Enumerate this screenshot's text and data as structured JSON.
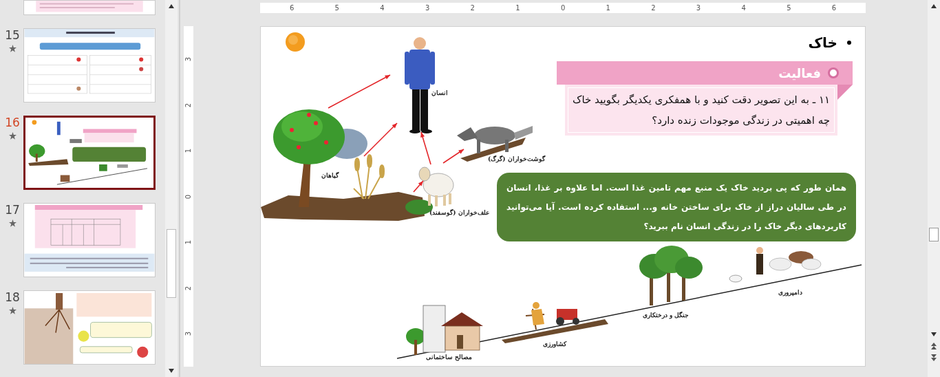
{
  "thumbnails": [
    {
      "kind": "partial",
      "selected": false
    },
    {
      "number": "15",
      "kind": "worksheet",
      "selected": false
    },
    {
      "number": "16",
      "kind": "current",
      "selected": true
    },
    {
      "number": "17",
      "kind": "activity",
      "selected": false
    },
    {
      "number": "18",
      "kind": "roots",
      "selected": false
    }
  ],
  "rulers": {
    "horizontal": [
      "6",
      "5",
      "4",
      "3",
      "2",
      "1",
      "0",
      "1",
      "2",
      "3",
      "4",
      "5",
      "6"
    ],
    "vertical": [
      "3",
      "2",
      "1",
      "0",
      "1",
      "2",
      "3"
    ]
  },
  "slide": {
    "heading": "خاک",
    "activity": {
      "title": "فعالیت",
      "question": "۱۱ ـ به این تصویر دقت کنید و با همفکری یکدیگر بگویید خاک چه اهمیتی در زندگی موجودات زنده دارد؟"
    },
    "note": "همان طور که پی بردید خاک یک منبع مهم تامین غذا است. اما علاوه بر غذا، انسان در طی سالیان دراز از خاک برای ساختن خانه و... استفاده کرده است. آیا می‌توانید کاربردهای دیگر خاک را در زندگی انسان نام ببرید؟",
    "food_chain_labels": [
      {
        "kind": "human",
        "text": "انسان"
      },
      {
        "kind": "plants",
        "text": "گیاهان"
      },
      {
        "kind": "carnivores",
        "text": "گوشت‌خواران (گرگ)"
      },
      {
        "kind": "herbivores",
        "text": "علف‌خواران (گوسفند)"
      }
    ],
    "uses_labels": [
      {
        "kind": "building",
        "text": "مصالح ساختمانی"
      },
      {
        "kind": "farming",
        "text": "کشاورزی"
      },
      {
        "kind": "forest",
        "text": "جنگل و درختکاری"
      },
      {
        "kind": "livestock",
        "text": "دامپروری"
      }
    ]
  }
}
